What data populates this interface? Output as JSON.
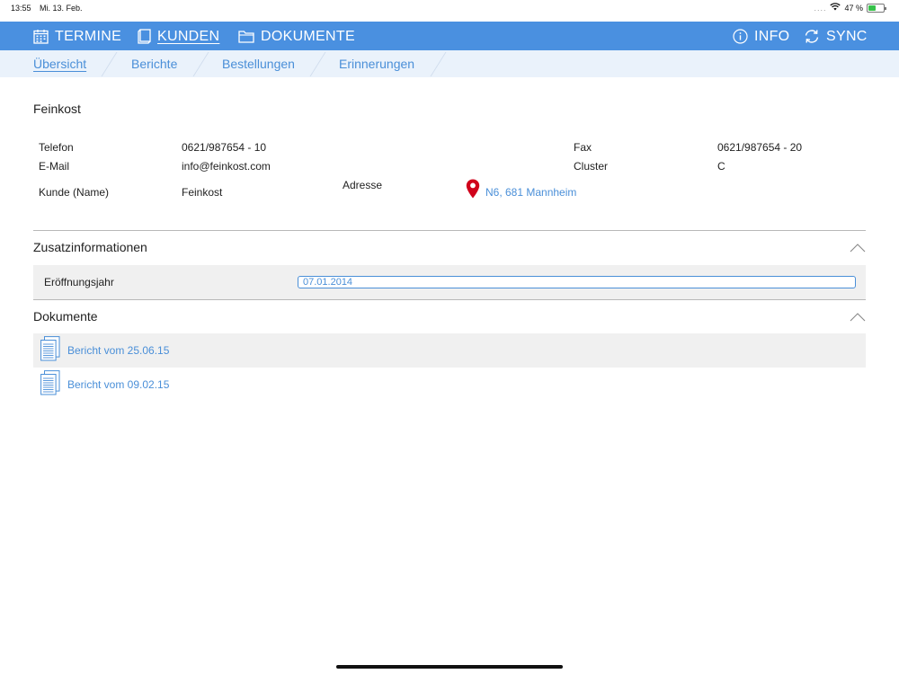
{
  "status": {
    "time": "13:55",
    "date": "Mi. 13. Feb.",
    "dots": "....",
    "battery": "47 %",
    "battery_level": 0.47
  },
  "nav": {
    "items": [
      {
        "label": "TERMINE",
        "icon": "calendar-icon"
      },
      {
        "label": "KUNDEN",
        "icon": "book-icon",
        "active": true
      },
      {
        "label": "DOKUMENTE",
        "icon": "folder-icon"
      },
      {
        "label": "INFO",
        "icon": "info-icon"
      },
      {
        "label": "SYNC",
        "icon": "sync-icon"
      }
    ]
  },
  "subnav": {
    "tabs": [
      {
        "label": "Übersicht",
        "active": true
      },
      {
        "label": "Berichte"
      },
      {
        "label": "Bestellungen"
      },
      {
        "label": "Erinnerungen"
      }
    ]
  },
  "customer": {
    "title": "Feinkost",
    "telefon_label": "Telefon",
    "telefon": "0621/987654 - 10",
    "email_label": "E-Mail",
    "email": "info@feinkost.com",
    "kunde_label": "Kunde (Name)",
    "kunde": "Feinkost",
    "adresse_label": "Adresse",
    "adresse": "N6, 681 Mannheim",
    "fax_label": "Fax",
    "fax": "0621/987654 - 20",
    "cluster_label": "Cluster",
    "cluster": "C"
  },
  "zusatz": {
    "title": "Zusatzinformationen",
    "field_label": "Eröffnungsjahr",
    "field_value": "07.01.2014"
  },
  "dokumente": {
    "title": "Dokumente",
    "items": [
      {
        "label": "Bericht vom 25.06.15"
      },
      {
        "label": "Bericht vom 09.02.15"
      }
    ]
  },
  "colors": {
    "accent": "#4a90e0",
    "link": "#4a8fd8",
    "pin": "#d0021b",
    "subnav_bg": "#eaf2fb"
  }
}
